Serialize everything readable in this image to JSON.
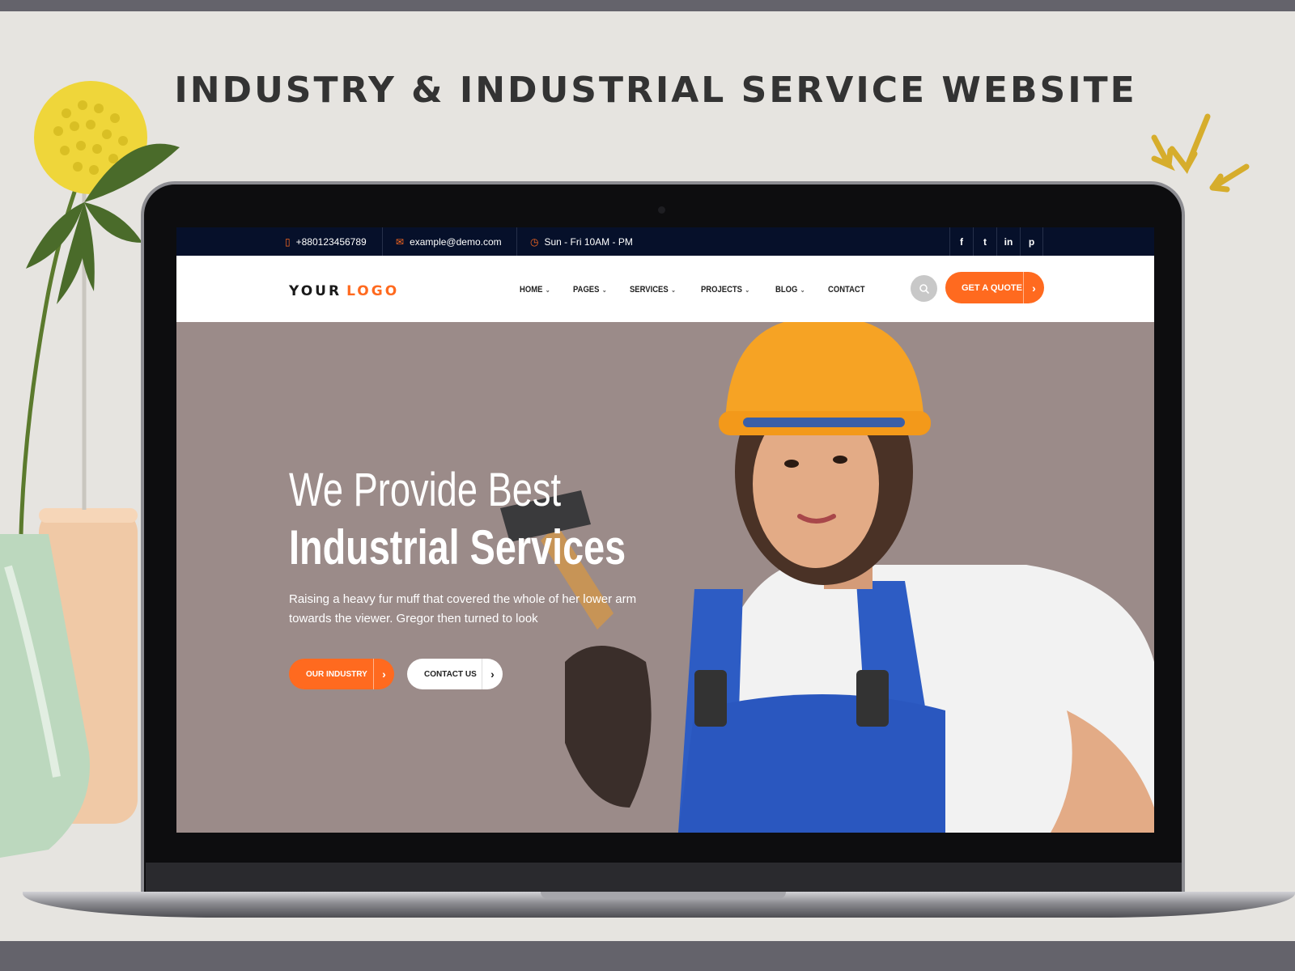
{
  "headline": "INDUSTRY & INDUSTRIAL SERVICE WEBSITE",
  "topbar": {
    "phone": "+880123456789",
    "email": "example@demo.com",
    "hours": "Sun - Fri 10AM - PM",
    "social": [
      {
        "icon": "facebook-icon",
        "glyph": "f"
      },
      {
        "icon": "twitter-icon",
        "glyph": "t"
      },
      {
        "icon": "linkedin-icon",
        "glyph": "in"
      },
      {
        "icon": "pinterest-icon",
        "glyph": "p"
      }
    ]
  },
  "logo": {
    "part1": "YOUR",
    "part2": "LOGO"
  },
  "nav": [
    {
      "label": "HOME",
      "dropdown": true
    },
    {
      "label": "PAGES",
      "dropdown": true
    },
    {
      "label": "SERVICES",
      "dropdown": true
    },
    {
      "label": "PROJECTS",
      "dropdown": true
    },
    {
      "label": "BLOG",
      "dropdown": true
    },
    {
      "label": "CONTACT",
      "dropdown": false
    }
  ],
  "quote_button": "GET A QUOTE",
  "hero": {
    "line1": "We Provide Best",
    "line2": "Industrial Services",
    "paragraph": "Raising a heavy fur muff that covered the whole of her lower arm towards the viewer. Gregor then turned to look",
    "button_primary": "OUR INDUSTRY",
    "button_secondary": "CONTACT US"
  },
  "colors": {
    "accent": "#ff6a1f",
    "topbar_bg": "#06102a",
    "hero_bg": "#9b8b89",
    "page_bg": "#e6e4e0",
    "sparkle": "#d6ad2c"
  }
}
